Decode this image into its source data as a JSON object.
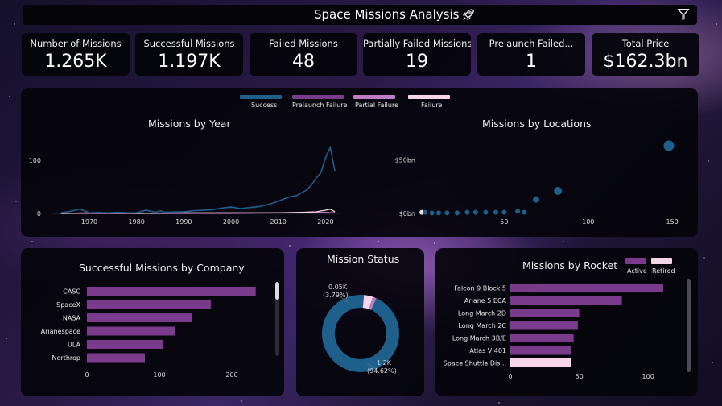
{
  "header": {
    "title": "Space Missions Analysis"
  },
  "kpis": [
    {
      "label": "Number of Missions",
      "value": "1.265K"
    },
    {
      "label": "Successful Missions",
      "value": "1.197K"
    },
    {
      "label": "Failed Missions",
      "value": "48"
    },
    {
      "label": "Partially Failed Missions",
      "value": "19"
    },
    {
      "label": "Prelaunch Failed...",
      "value": "1"
    },
    {
      "label": "Total Price",
      "value": "$162.3bn"
    }
  ],
  "legend": {
    "items": [
      {
        "label": "Success",
        "color": "#1f5f8b"
      },
      {
        "label": "Prelaunch Failure",
        "color": "#7a3b8c"
      },
      {
        "label": "Partial Failure",
        "color": "#c07bc6"
      },
      {
        "label": "Failure",
        "color": "#f7d6e8"
      }
    ]
  },
  "chart_data": [
    {
      "type": "line",
      "title": "Missions by Year",
      "x_ticks": [
        "1970",
        "1980",
        "1990",
        "2000",
        "2010",
        "2020"
      ],
      "y_ticks": [
        "0",
        "100"
      ],
      "xlim": [
        1962,
        2023
      ],
      "ylim": [
        0,
        130
      ],
      "series": [
        {
          "name": "Success",
          "color": "#1f5f8b",
          "x": [
            1964,
            1966,
            1968,
            1969,
            1970,
            1972,
            1974,
            1976,
            1978,
            1980,
            1982,
            1984,
            1985,
            1986,
            1988,
            1990,
            1992,
            1994,
            1996,
            1998,
            2000,
            2002,
            2004,
            2006,
            2008,
            2010,
            2012,
            2014,
            2016,
            2017,
            2018,
            2019,
            2020,
            2021,
            2022
          ],
          "y": [
            1,
            4,
            8,
            5,
            1,
            2,
            1,
            2,
            1,
            1,
            6,
            2,
            5,
            2,
            3,
            3,
            5,
            6,
            7,
            10,
            12,
            9,
            11,
            13,
            17,
            23,
            30,
            34,
            44,
            53,
            66,
            76,
            104,
            124,
            80
          ]
        },
        {
          "name": "Failure",
          "color": "#f7d6e8",
          "x": [
            1964,
            1970,
            1980,
            1990,
            2000,
            2010,
            2015,
            2018,
            2020,
            2021,
            2022
          ],
          "y": [
            0,
            1,
            0,
            1,
            1,
            1,
            2,
            3,
            6,
            8,
            3
          ]
        },
        {
          "name": "Partial Failure",
          "color": "#c07bc6",
          "x": [
            1964,
            1980,
            2000,
            2010,
            2020,
            2022
          ],
          "y": [
            0,
            0,
            0,
            1,
            2,
            1
          ]
        }
      ]
    },
    {
      "type": "scatter",
      "title": "Missions by Locations",
      "x_ticks": [
        "50",
        "100",
        "150"
      ],
      "y_ticks": [
        "$0bn",
        "$50bn"
      ],
      "xlim": [
        0,
        160
      ],
      "ylim": [
        0,
        60
      ],
      "points": [
        {
          "x": 1,
          "y": 1,
          "color": "#f7d6e8"
        },
        {
          "x": 3,
          "y": 1,
          "color": "#1f5f8b"
        },
        {
          "x": 7,
          "y": 0.5,
          "color": "#1f5f8b"
        },
        {
          "x": 11,
          "y": 0.5,
          "color": "#1f5f8b"
        },
        {
          "x": 16,
          "y": 0.5,
          "color": "#1f5f8b"
        },
        {
          "x": 22,
          "y": 0.5,
          "color": "#1f5f8b"
        },
        {
          "x": 28,
          "y": 1,
          "color": "#1f5f8b"
        },
        {
          "x": 33,
          "y": 1,
          "color": "#1f5f8b"
        },
        {
          "x": 39,
          "y": 1,
          "color": "#1f5f8b"
        },
        {
          "x": 45,
          "y": 1,
          "color": "#1f5f8b"
        },
        {
          "x": 50,
          "y": 1,
          "color": "#1f5f8b"
        },
        {
          "x": 58,
          "y": 2,
          "color": "#1f5f8b"
        },
        {
          "x": 62,
          "y": 1,
          "color": "#1f5f8b"
        },
        {
          "x": 69,
          "y": 13,
          "color": "#1f5f8b"
        },
        {
          "x": 82,
          "y": 21,
          "color": "#1f5f8b"
        },
        {
          "x": 148,
          "y": 63,
          "color": "#1f5f8b"
        }
      ]
    },
    {
      "type": "bar",
      "title": "Successful Missions by Company",
      "categories": [
        "CASC",
        "SpaceX",
        "NASA",
        "Arianespace",
        "ULA",
        "Northrop"
      ],
      "values": [
        233,
        171,
        145,
        122,
        105,
        80
      ],
      "x_ticks": [
        "0",
        "100",
        "200"
      ],
      "xlim": [
        0,
        260
      ],
      "color": "#7a3b8c"
    },
    {
      "type": "pie",
      "title": "Mission Status",
      "slices": [
        {
          "label": "1.2K",
          "pct": "(94.62%)",
          "value": 94.62,
          "color": "#1f5f8b"
        },
        {
          "label": "0.05K",
          "pct": "(3.79%)",
          "value": 3.79,
          "color": "#f7d6e8"
        },
        {
          "value": 1.5,
          "color": "#c07bc6"
        }
      ]
    },
    {
      "type": "bar",
      "title": "Missions by Rocket",
      "legend": [
        {
          "label": "Active",
          "color": "#7a3b8c"
        },
        {
          "label": "Retired",
          "color": "#f7d6e8"
        }
      ],
      "categories": [
        "Falcon 9 Block 5",
        "Ariane 5 ECA",
        "Long March 2D",
        "Long March 2C",
        "Long March 3B/E",
        "Atlas V 401",
        "Space Shuttle Dis..."
      ],
      "values": [
        111,
        81,
        50,
        49,
        46,
        44,
        44
      ],
      "status": [
        "Active",
        "Active",
        "Active",
        "Active",
        "Active",
        "Active",
        "Retired"
      ],
      "x_ticks": [
        "0",
        "50",
        "100"
      ],
      "xlim": [
        0,
        125
      ]
    }
  ]
}
